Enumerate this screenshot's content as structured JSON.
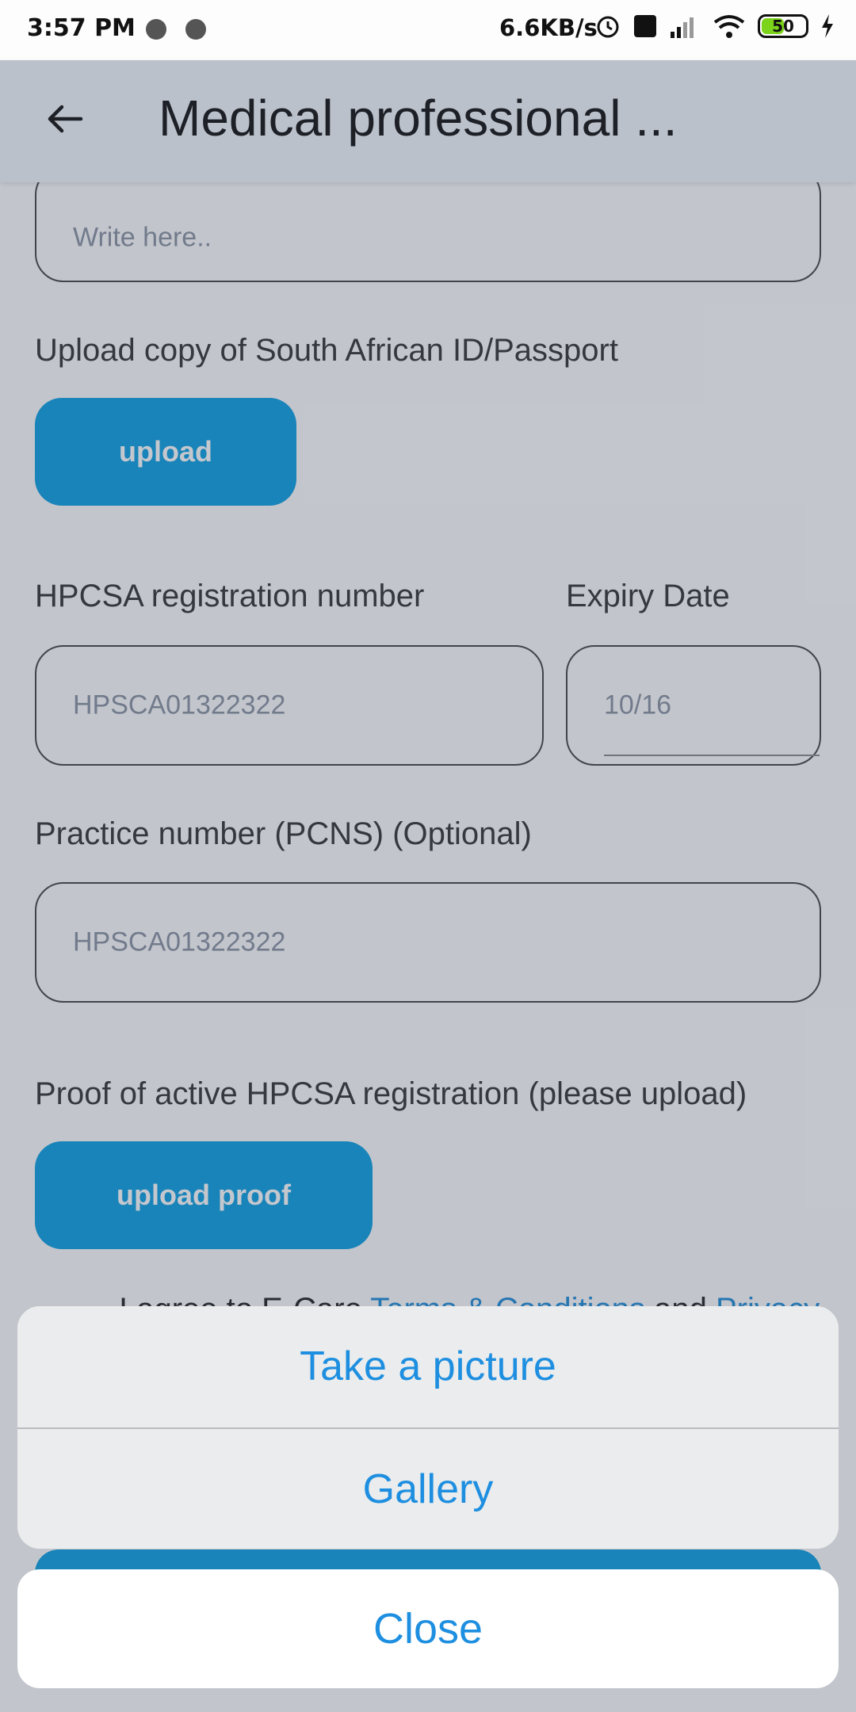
{
  "status_bar": {
    "time": "3:57 PM",
    "speed": "6.6KB/s",
    "battery": "50",
    "icons": [
      "alarm-icon",
      "volte-icon",
      "signal-icon",
      "wifi-icon",
      "battery-icon",
      "charging-icon"
    ]
  },
  "appbar": {
    "title": "Medical professional ..."
  },
  "form": {
    "top_field_placeholder": "Write here..",
    "id_label": "Upload copy of South African ID/Passport",
    "upload_button": "upload",
    "hpcsa_label": "HPCSA registration number",
    "hpcsa_value": "HPSCA01322322",
    "expiry_label": "Expiry Date",
    "expiry_value": "10/16",
    "practice_label": "Practice number (PCNS) (Optional)",
    "practice_value": "HPSCA01322322",
    "proof_label": "Proof of active HPCSA registration (please upload)",
    "upload_proof_button": "upload proof",
    "terms_prefix": "I agree to E-Care ",
    "terms_link": "Terms & Conditions",
    "terms_mid": " and ",
    "privacy_link": "Privacy"
  },
  "action_sheet": {
    "take_picture": "Take a picture",
    "gallery": "Gallery",
    "close": "Close"
  },
  "colors": {
    "accent": "#0b9fe3",
    "link": "#1e8fe0"
  }
}
